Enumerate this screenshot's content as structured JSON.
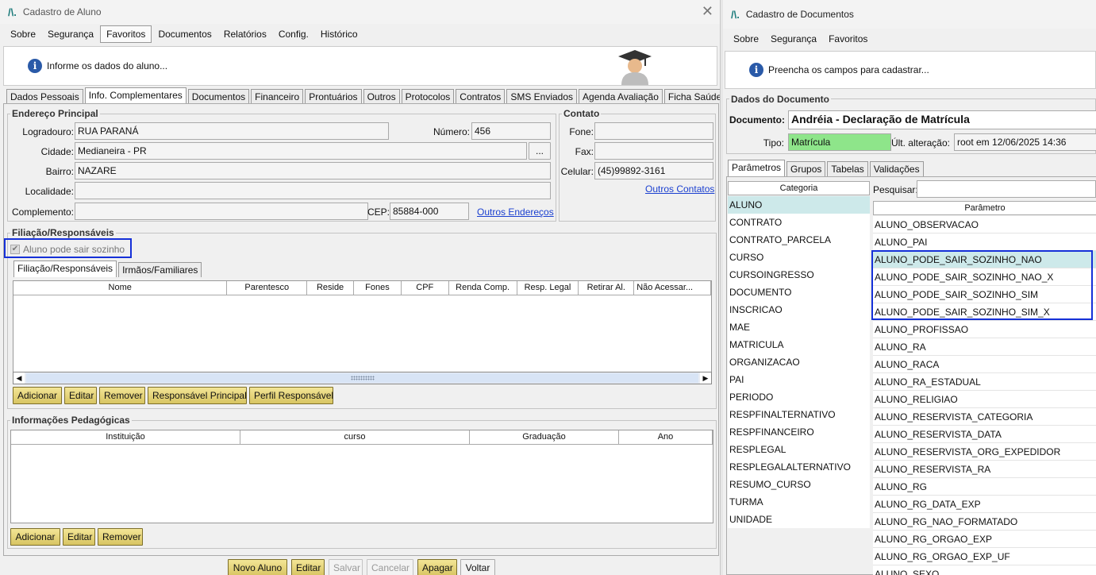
{
  "win1": {
    "title": "Cadastro de Aluno",
    "close": "✕",
    "menu": [
      "Sobre",
      "Segurança",
      "Favoritos",
      "Documentos",
      "Relatórios",
      "Config.",
      "Histórico"
    ],
    "info": "Informe os dados do aluno...",
    "tabs": [
      "Dados Pessoais",
      "Info. Complementares",
      "Documentos",
      "Financeiro",
      "Prontuários",
      "Outros",
      "Protocolos",
      "Contratos",
      "SMS Enviados",
      "Agenda Avaliação",
      "Ficha Saúde"
    ],
    "endereco": {
      "legend": "Endereço Principal",
      "logradouro_label": "Logradouro:",
      "logradouro": "RUA PARANÁ",
      "numero_label": "Número:",
      "numero": "456",
      "cidade_label": "Cidade:",
      "cidade": "Medianeira - PR",
      "cidade_btn": "...",
      "bairro_label": "Bairro:",
      "bairro": "NAZARE",
      "localidade_label": "Localidade:",
      "localidade": "",
      "complemento_label": "Complemento:",
      "complemento": "",
      "cep_label": "CEP:",
      "cep": "85884-000",
      "outros_enderecos": "Outros Endereços"
    },
    "contato": {
      "legend": "Contato",
      "fone_label": "Fone:",
      "fone": "",
      "fax_label": "Fax:",
      "fax": "",
      "celular_label": "Celular:",
      "celular": "(45)99892-3161",
      "outros_contatos": "Outros Contatos"
    },
    "filiacao": {
      "legend": "Filiação/Responsáveis",
      "checkbox": "Aluno pode sair sozinho",
      "subtabs": [
        "Filiação/Responsáveis",
        "Irmãos/Familiares"
      ],
      "columns": [
        "Nome",
        "Parentesco",
        "Reside",
        "Fones",
        "CPF",
        "Renda Comp.",
        "Resp. Legal",
        "Retirar Al.",
        "Não Acessar..."
      ],
      "buttons": [
        "Adicionar",
        "Editar",
        "Remover",
        "Responsável Principal",
        "Perfil Responsável"
      ]
    },
    "pedagogicas": {
      "legend": "Informações Pedagógicas",
      "columns": [
        "Instituição",
        "curso",
        "Graduação",
        "Ano"
      ],
      "buttons": [
        "Adicionar",
        "Editar",
        "Remover"
      ]
    },
    "footer_buttons": [
      "Novo Aluno",
      "Editar",
      "Salvar",
      "Cancelar",
      "Apagar",
      "Voltar"
    ]
  },
  "win2": {
    "title": "Cadastro de Documentos",
    "menu": [
      "Sobre",
      "Segurança",
      "Favoritos"
    ],
    "info": "Preencha os campos para cadastrar...",
    "dados_legend": "Dados do Documento",
    "documento_label": "Documento:",
    "documento": "Andréia - Declaração de Matrícula",
    "tipo_label": "Tipo:",
    "tipo": "Matrícula",
    "ult_label": "Últ. alteração:",
    "ult": "root em 12/06/2025 14:36",
    "tabs": [
      "Parâmetros",
      "Grupos",
      "Tabelas",
      "Validações"
    ],
    "categoria_header": "Categoria",
    "categorias": [
      "ALUNO",
      "CONTRATO",
      "CONTRATO_PARCELA",
      "CURSO",
      "CURSOINGRESSO",
      "DOCUMENTO",
      "INSCRICAO",
      "MAE",
      "MATRICULA",
      "ORGANIZACAO",
      "PAI",
      "PERIODO",
      "RESPFINALTERNATIVO",
      "RESPFINANCEIRO",
      "RESPLEGAL",
      "RESPLEGALALTERNATIVO",
      "RESUMO_CURSO",
      "TURMA",
      "UNIDADE"
    ],
    "pesquisar_label": "Pesquisar:",
    "pesquisar": "",
    "parametro_header": "Parâmetro",
    "parametros": [
      "ALUNO_OBSERVACAO",
      "ALUNO_PAI",
      "ALUNO_PODE_SAIR_SOZINHO_NAO",
      "ALUNO_PODE_SAIR_SOZINHO_NAO_X",
      "ALUNO_PODE_SAIR_SOZINHO_SIM",
      "ALUNO_PODE_SAIR_SOZINHO_SIM_X",
      "ALUNO_PROFISSAO",
      "ALUNO_RA",
      "ALUNO_RACA",
      "ALUNO_RA_ESTADUAL",
      "ALUNO_RELIGIAO",
      "ALUNO_RESERVISTA_CATEGORIA",
      "ALUNO_RESERVISTA_DATA",
      "ALUNO_RESERVISTA_ORG_EXPEDIDOR",
      "ALUNO_RESERVISTA_RA",
      "ALUNO_RG",
      "ALUNO_RG_DATA_EXP",
      "ALUNO_RG_NAO_FORMATADO",
      "ALUNO_RG_ORGAO_EXP",
      "ALUNO_RG_ORGAO_EXP_UF",
      "ALUNO_SEXO"
    ]
  },
  "colors": {
    "highlight": "#1530d8",
    "selected_row": "#cde9ea",
    "tipo_bg": "#8ee58a",
    "button": "#e6d47a"
  }
}
